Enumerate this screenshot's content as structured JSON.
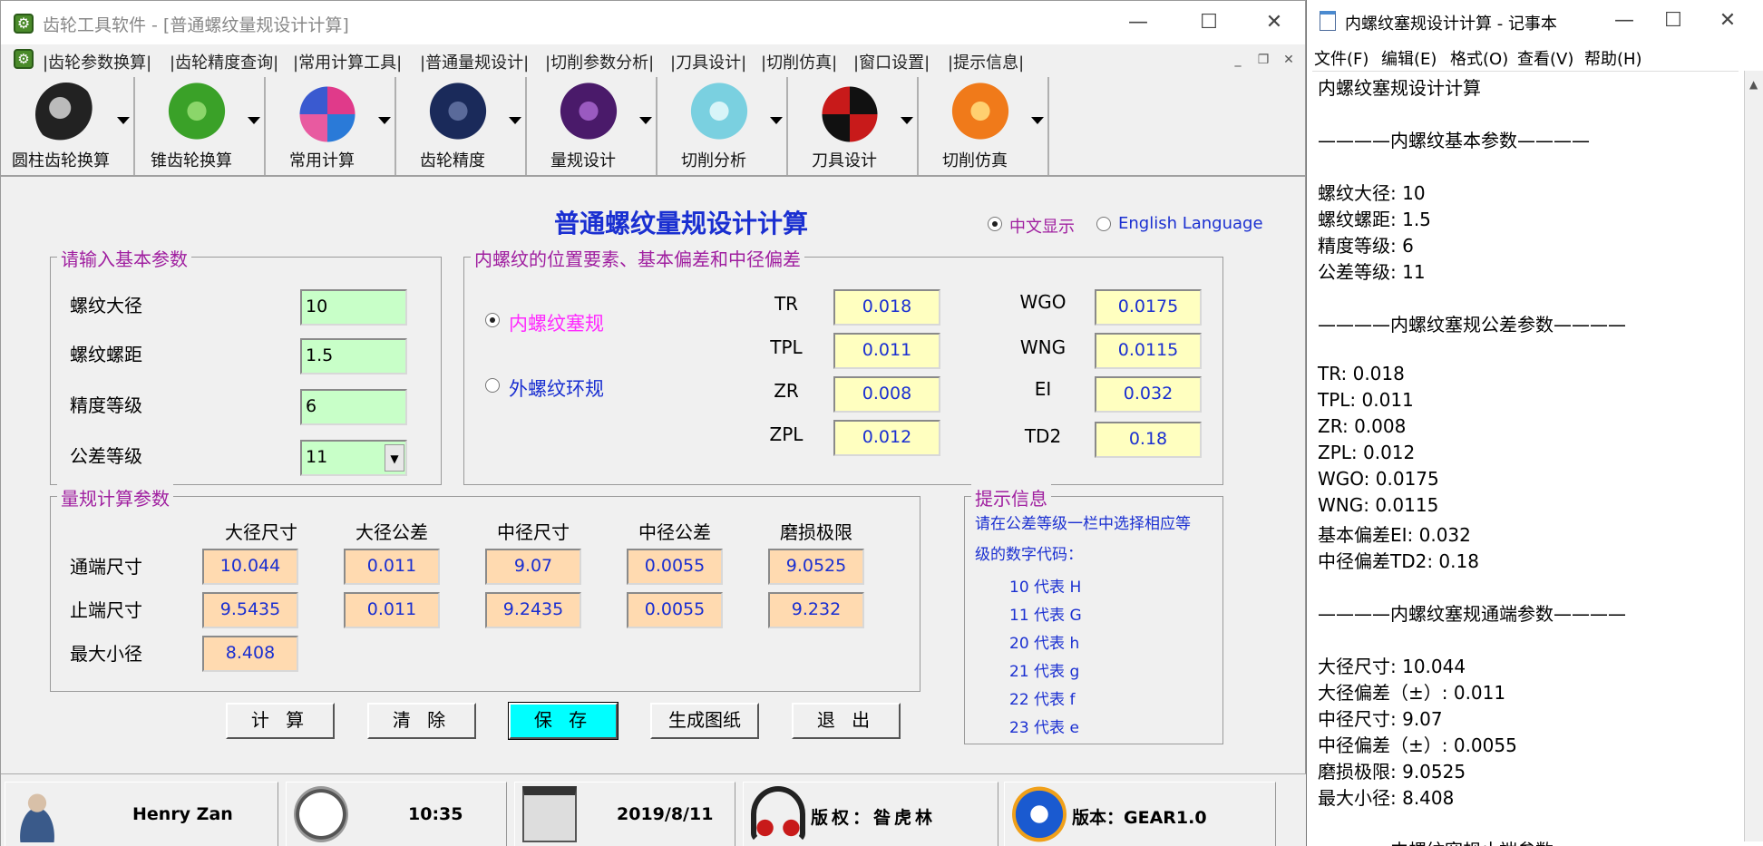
{
  "app": {
    "title": "齿轮工具软件 - [普通螺纹量规设计计算]",
    "menu": [
      "|齿轮参数换算|",
      "|齿轮精度查询|",
      "|常用计算工具|",
      "|普通量规设计|",
      "|切削参数分析|",
      "|刀具设计|",
      "|切削仿真|",
      "|窗口设置|",
      "|提示信息|"
    ],
    "toolbar": [
      "圆柱齿轮换算",
      "锥齿轮换算",
      "常用计算",
      "齿轮精度",
      "量规设计",
      "切削分析",
      "刀具设计",
      "切削仿真"
    ],
    "heading": "普通螺纹量规设计计算",
    "lang_cn": "中文显示",
    "lang_en": "English Language",
    "basic": {
      "title": "请输入基本参数",
      "labels": [
        "螺纹大径",
        "螺纹螺距",
        "精度等级",
        "公差等级"
      ],
      "values": [
        "10",
        "1.5",
        "6",
        "11"
      ]
    },
    "position": {
      "title": "内螺纹的位置要素、基本偏差和中径偏差",
      "opt_plug": "内螺纹塞规",
      "opt_ring": "外螺纹环规",
      "left_labels": [
        "TR",
        "TPL",
        "ZR",
        "ZPL"
      ],
      "left_values": [
        "0.018",
        "0.011",
        "0.008",
        "0.012"
      ],
      "right_labels": [
        "WGO",
        "WNG",
        "EI",
        "TD2"
      ],
      "right_values": [
        "0.0175",
        "0.0115",
        "0.032",
        "0.18"
      ]
    },
    "calc": {
      "title": "量规计算参数",
      "cols": [
        "大径尺寸",
        "大径公差",
        "中径尺寸",
        "中径公差",
        "磨损极限"
      ],
      "rows": [
        "通端尺寸",
        "止端尺寸",
        "最大小径"
      ],
      "go": [
        "10.044",
        "0.011",
        "9.07",
        "0.0055",
        "9.0525"
      ],
      "nogo": [
        "9.5435",
        "0.011",
        "9.2435",
        "0.0055",
        "9.232"
      ],
      "minor": "8.408"
    },
    "hint": {
      "title": "提示信息",
      "line1": "请在公差等级一栏中选择相应等",
      "line2": "级的数字代码：",
      "codes": [
        "10 代表 H",
        "11 代表 G",
        "20 代表 h",
        "21 代表 g",
        "22 代表 f",
        "23 代表 e"
      ]
    },
    "buttons": [
      "计 算",
      "清 除",
      "保 存",
      "生成图纸",
      "退 出"
    ],
    "status": {
      "user": "Henry Zan",
      "time": "10:35",
      "date": "2019/8/11",
      "copyright": "版权：昝虎林",
      "version": "版本：GEAR1.0"
    }
  },
  "notepad": {
    "title": "内螺纹塞规设计计算 - 记事本",
    "menu": [
      "文件(F)",
      "编辑(E)",
      "格式(O)",
      "查看(V)",
      "帮助(H)"
    ],
    "lines": [
      "内螺纹塞规设计计算",
      "",
      "————内螺纹基本参数————",
      "",
      "螺纹大径:        10",
      "螺纹螺距:        1.5",
      "精度等级:        6",
      "公差等级:        11",
      "",
      "————内螺纹塞规公差参数————",
      "",
      "TR:                0.018",
      "TPL:               0.011",
      "ZR:                0.008",
      "ZPL:               0.012",
      "WGO:               0.0175",
      "WNG:               0.0115",
      "基本偏差EI:        0.032",
      "中径偏差TD2:       0.18",
      "",
      "————内螺纹塞规通端参数————",
      "",
      "大径尺寸:        10.044",
      "大径偏差（±）:     0.011",
      "中径尺寸:        9.07",
      "中径偏差（±）:     0.0055",
      "磨损极限:        9.0525",
      "最大小径:        8.408",
      "",
      "————内螺纹塞规止端参数————"
    ]
  }
}
